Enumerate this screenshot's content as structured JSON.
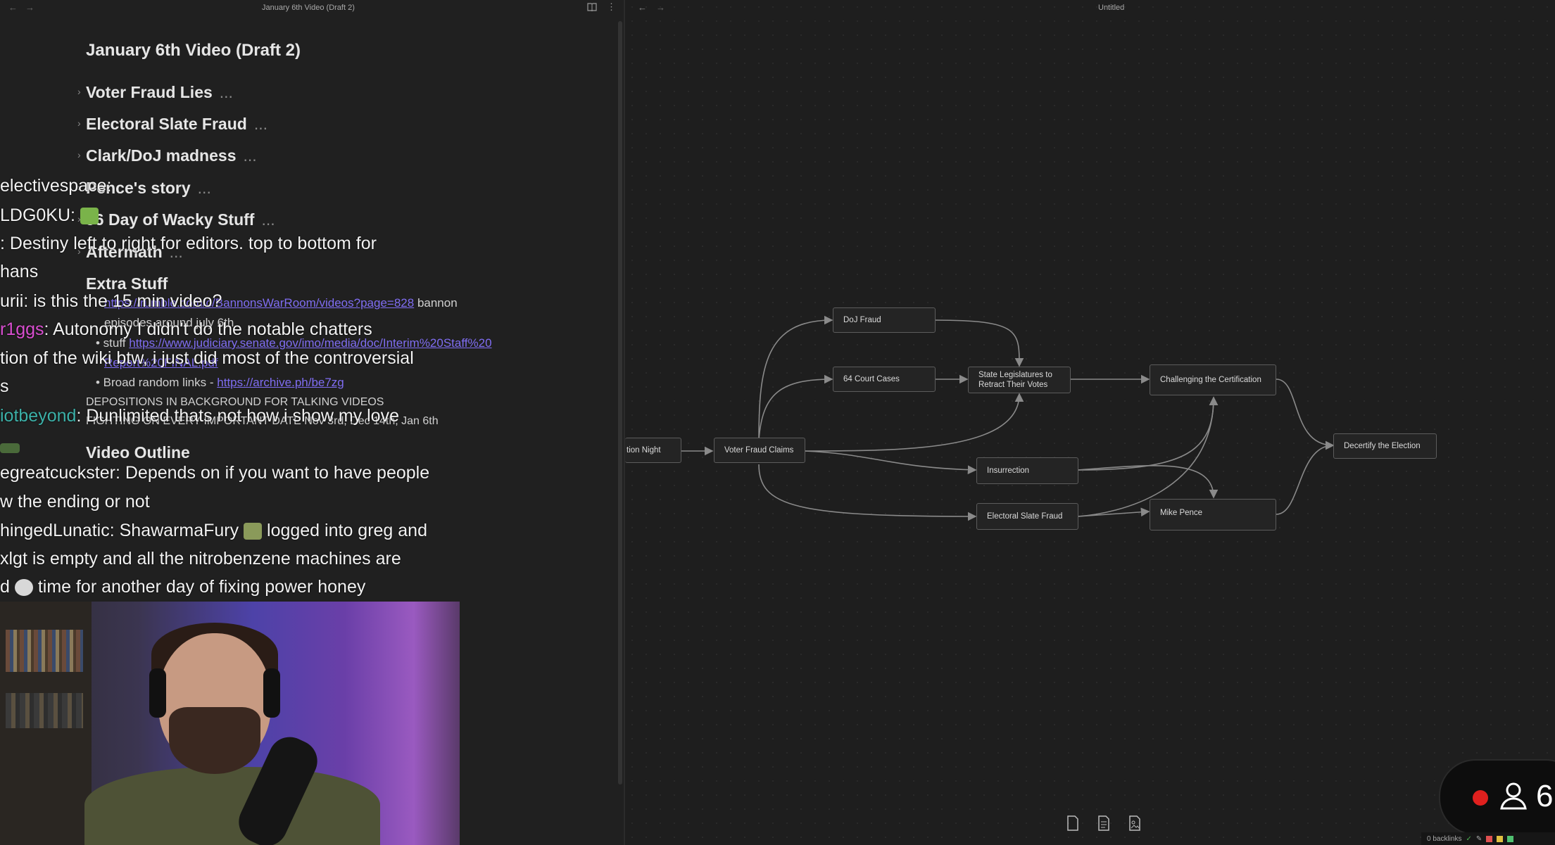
{
  "left_pane": {
    "tab_title": "January 6th Video (Draft 2)",
    "doc_title": "January 6th Video (Draft 2)",
    "collapsed_dots": "...",
    "headings": [
      {
        "text": "Voter Fraud Lies"
      },
      {
        "text": "Electoral Slate Fraud"
      },
      {
        "text": "Clark/DoJ madness"
      },
      {
        "text": "Pence's story"
      },
      {
        "text": "J6 Day of Wacky Stuff"
      },
      {
        "text": "Aftermath"
      }
    ],
    "extra_stuff_heading": "Extra Stuff",
    "extra_items": {
      "line1_link": "https://rumble.com/c/BannonsWarRoom/videos?page=828",
      "line1_text": "bannon",
      "line1_cont": "episodes around july 6th",
      "line2_prefix": "• stuff",
      "line2_link": "https://www.judiciary.senate.gov/imo/media/doc/Interim%20Staff%20",
      "line2_link_cont": "Report%20FINAL.pdf",
      "line3_prefix": "• Broad random links -",
      "line3_link": "https://archive.ph/be7zg"
    },
    "depositions": "DEPOSITIONS IN BACKGROUND FOR TALKING VIDEOS",
    "fighting": "FIGHTING ON EVERY IMPORTANT DATE Nov 3rd, Dec 14th, Jan 6th",
    "video_outline": "Video Outline"
  },
  "chat_overlay": [
    {
      "user": "electivespace",
      "sep": ":",
      "text": ""
    },
    {
      "user": "LDG0KU",
      "sep": ":",
      "text": ""
    },
    {
      "user": "",
      "sep": ":",
      "text": "Destiny left to right for editors. top to bottom for"
    },
    {
      "user": "",
      "sep": "",
      "text": "hans"
    },
    {
      "user": "urii",
      "sep": ":",
      "text": "is this the 15 min video?"
    },
    {
      "user": "r1ggs",
      "sep": ":",
      "text": "Autonomy I didn't do the notable chatters"
    },
    {
      "user": "",
      "sep": "",
      "text": "tion of the wiki btw, i just did most of the controversial"
    },
    {
      "user": "",
      "sep": "",
      "text": "s"
    },
    {
      "user": "iotbeyond",
      "sep": ":",
      "text": "Dunlimited thats not how i show my love"
    },
    {
      "user": "",
      "sep": "",
      "text": ""
    },
    {
      "user": "egreatcuckster",
      "sep": ":",
      "text": "Depends on if you want to have people"
    },
    {
      "user": "",
      "sep": "",
      "text": "w the ending or not"
    },
    {
      "user": "hingedLunatic",
      "sep": ":",
      "text": "ShawarmaFury"
    },
    {
      "user": "",
      "sep": "",
      "text": "logged into greg and"
    },
    {
      "user": "",
      "sep": "",
      "text": "xlgt is empty and all the nitrobenzene machines are"
    },
    {
      "user": "",
      "sep": "",
      "text": "d"
    },
    {
      "user": "",
      "sep": "",
      "text": "time for another day of fixing power honey"
    }
  ],
  "right_pane": {
    "tab_title": "Untitled",
    "nodes": {
      "election_night": "tion Night",
      "voter_fraud": "Voter Fraud Claims",
      "doj_fraud": "DoJ Fraud",
      "court_cases": "64 Court Cases",
      "state_leg_1": "State Legislatures to",
      "state_leg_2": "Retract Their Votes",
      "challenging": "Challenging the Certification",
      "insurrection": "Insurrection",
      "electoral_slate": "Electoral Slate Fraud",
      "mike_pence": "Mike Pence",
      "decertify": "Decertify the Election"
    }
  },
  "status": {
    "backlinks": "0 backlinks",
    "viewer_count": "6"
  },
  "colors": {
    "link": "#7f6df2",
    "accent_green": "#53c68c",
    "accent_pink": "#d94fd0",
    "record": "#e0201e"
  },
  "icons": [
    "file-icon",
    "document-icon",
    "image-file-icon",
    "book-icon",
    "more-icon",
    "back-arrow-icon",
    "forward-arrow-icon",
    "user-icon"
  ]
}
